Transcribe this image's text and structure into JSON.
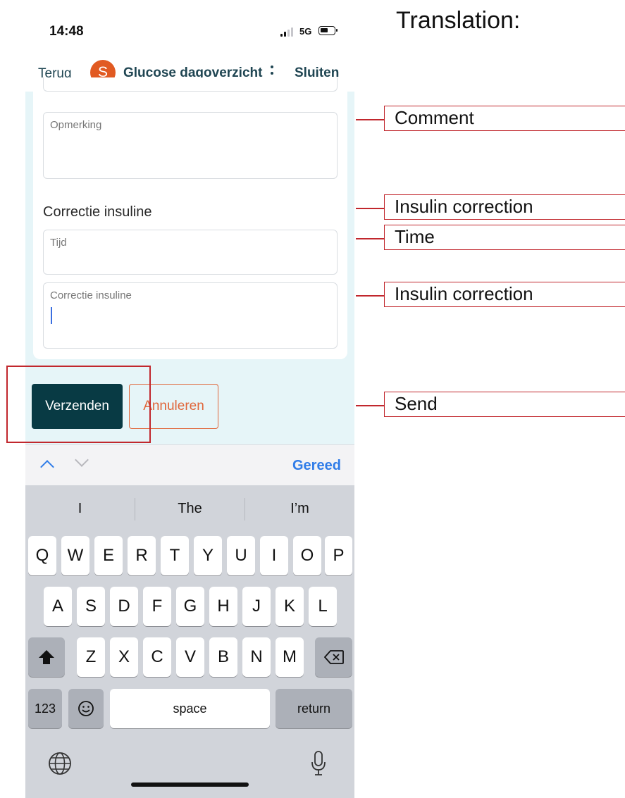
{
  "status_bar": {
    "time": "14:48",
    "network": "5G"
  },
  "nav": {
    "back_label": "Terug",
    "avatar_letter": "S",
    "title": "Glucose dagoverzicht",
    "close_label": "Sluiten"
  },
  "form": {
    "comment_label": "Opmerking",
    "section_title": "Correctie insuline",
    "time_label": "Tijd",
    "correction_label": "Correctie insuline",
    "send_label": "Verzenden",
    "cancel_label": "Annuleren"
  },
  "keyboard": {
    "done_label": "Gereed",
    "suggestions": [
      "I",
      "The",
      "I’m"
    ],
    "rows": [
      [
        "Q",
        "W",
        "E",
        "R",
        "T",
        "Y",
        "U",
        "I",
        "O",
        "P"
      ],
      [
        "A",
        "S",
        "D",
        "F",
        "G",
        "H",
        "J",
        "K",
        "L"
      ],
      [
        "Z",
        "X",
        "C",
        "V",
        "B",
        "N",
        "M"
      ]
    ],
    "numbers_label": "123",
    "space_label": "space",
    "return_label": "return"
  },
  "annotations": {
    "title": "Translation:",
    "comment": "Comment",
    "insulin_correction_section": "Insulin correction",
    "time": "Time",
    "insulin_correction_field": "Insulin correction",
    "send": "Send"
  },
  "colors": {
    "brand_dark": "#083a44",
    "accent_orange": "#e0663a",
    "ios_blue": "#2f7ce8",
    "annotation_red": "#c1272d"
  }
}
